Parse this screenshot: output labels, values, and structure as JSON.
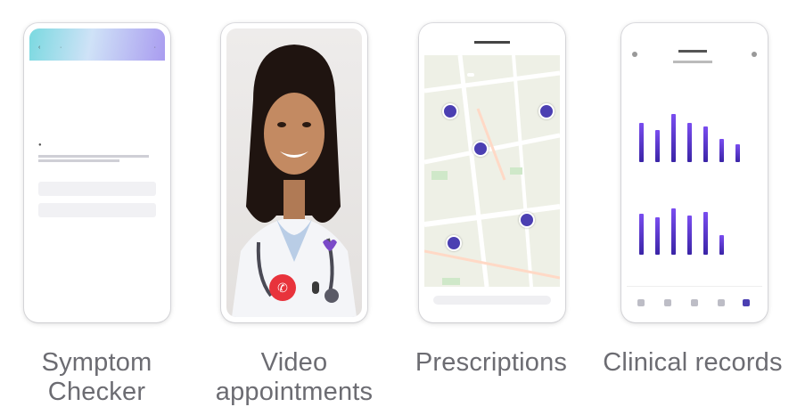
{
  "features": [
    {
      "caption_line1": "Symptom",
      "caption_line2": "Checker"
    },
    {
      "caption_line1": "Video",
      "caption_line2": "appointments"
    },
    {
      "caption_line1": "Prescriptions",
      "caption_line2": ""
    },
    {
      "caption_line1": "Clinical records",
      "caption_line2": ""
    }
  ],
  "colors": {
    "caption": "#6c6c72",
    "accent": "#4b3fb2",
    "end_call": "#e8333c"
  },
  "icons": [
    "phone-hangup-icon",
    "microphone-icon",
    "map-pin-icon"
  ]
}
